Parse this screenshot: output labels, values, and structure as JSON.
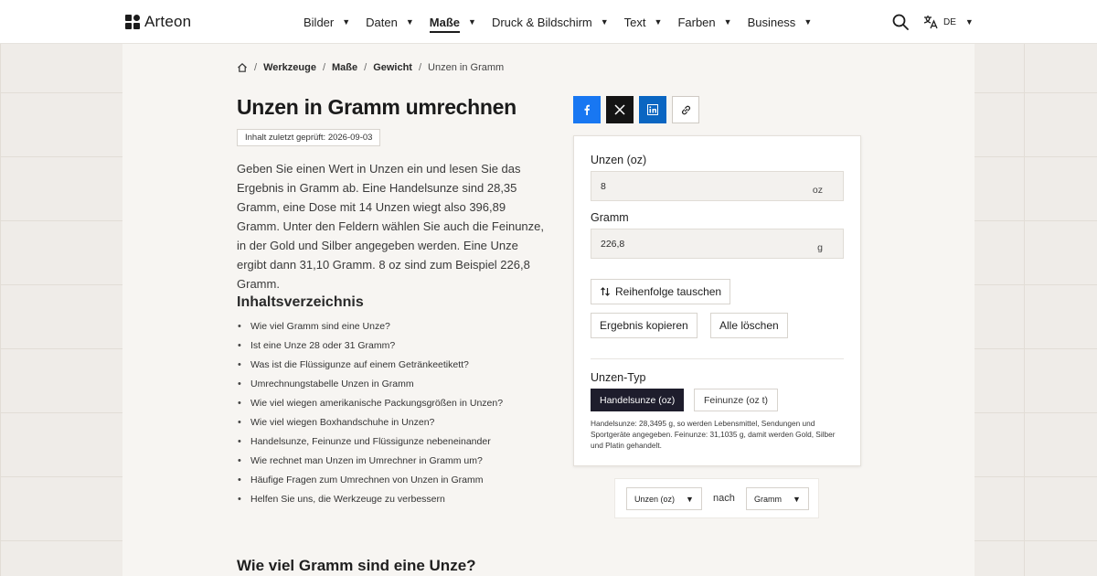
{
  "header": {
    "logo_text": "Arteon",
    "nav": [
      {
        "label": "Bilder"
      },
      {
        "label": "Daten"
      },
      {
        "label": "Maße"
      },
      {
        "label": "Druck & Bildschirm"
      },
      {
        "label": "Text"
      },
      {
        "label": "Farben"
      },
      {
        "label": "Business"
      }
    ],
    "active_nav": "Maße",
    "language": "DE"
  },
  "breadcrumb": {
    "items": [
      "Werkzeuge",
      "Maße",
      "Gewicht"
    ],
    "current": "Unzen in Gramm"
  },
  "page": {
    "title": "Unzen in Gramm umrechnen",
    "review_badge": "Inhalt zuletzt geprüft: 2026-09-03",
    "intro": "Geben Sie einen Wert in Unzen ein und lesen Sie das Ergebnis in Gramm ab. Eine Handelsunze sind 28,35 Gramm, eine Dose mit 14 Unzen wiegt also 396,89 Gramm. Unter den Feldern wählen Sie auch die Feinunze, in der Gold und Silber angegeben werden. Eine Unze ergibt dann 31,10 Gramm. 8 oz sind zum Beispiel 226,8 Gramm.",
    "toc_title": "Inhaltsverzeichnis",
    "toc": [
      "Wie viel Gramm sind eine Unze?",
      "Ist eine Unze 28 oder 31 Gramm?",
      "Was ist die Flüssigunze auf einem Getränkeetikett?",
      "Umrechnungstabelle Unzen in Gramm",
      "Wie viel wiegen amerikanische Packungsgrößen in Unzen?",
      "Wie viel wiegen Boxhandschuhe in Unzen?",
      "Handelsunze, Feinunze und Flüssigunze nebeneinander",
      "Wie rechnet man Unzen im Umrechner in Gramm um?",
      "Häufige Fragen zum Umrechnen von Unzen in Gramm",
      "Helfen Sie uns, die Werkzeuge zu verbessern"
    ],
    "section_title": "Wie viel Gramm sind eine Unze?"
  },
  "converter": {
    "input_label": "Unzen (oz)",
    "input_value": "8",
    "input_unit": "oz",
    "output_label": "Gramm",
    "output_value": "226,8",
    "output_unit": "g",
    "swap_button": "Reihenfolge tauschen",
    "copy_button": "Ergebnis kopieren",
    "clear_button": "Alle löschen",
    "type_label": "Unzen-Typ",
    "type_options": [
      "Handelsunze (oz)",
      "Feinunze (oz t)"
    ],
    "type_selected": "Handelsunze (oz)",
    "type_note": "Handelsunze: 28,3495 g, so werden Lebensmittel, Sendungen und Sportgeräte angegeben. Feinunze: 31,1035 g, damit werden Gold, Silber und Platin gehandelt."
  },
  "unit_selector": {
    "from": "Unzen (oz)",
    "connector": "nach",
    "to": "Gramm"
  },
  "colors": {
    "facebook": "#1877f2",
    "x": "#141414",
    "linkedin": "#0a66c2",
    "segment_active": "#1e1d2c"
  }
}
